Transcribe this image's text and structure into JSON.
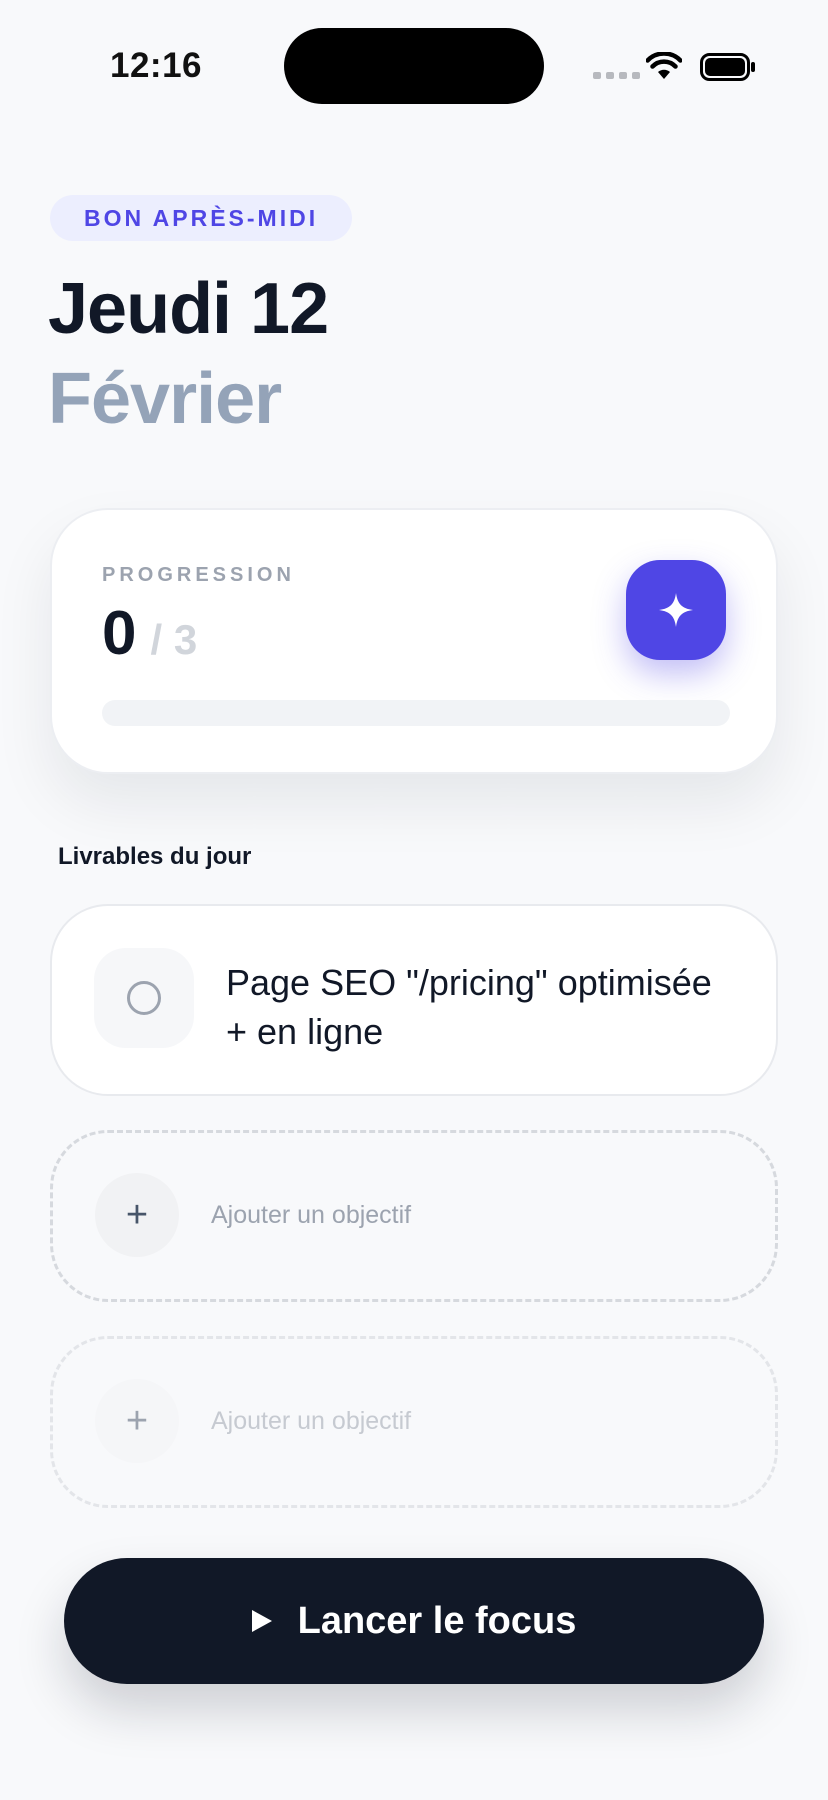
{
  "status_bar": {
    "time": "12:16"
  },
  "header": {
    "greeting": "BON APRÈS-MIDI",
    "day": "Jeudi 12",
    "month": "Février"
  },
  "progress": {
    "label": "PROGRESSION",
    "done": "0",
    "total": "/ 3",
    "fraction": 0,
    "accent": "#4f46e5",
    "icon": "sparkle-icon"
  },
  "section": {
    "title": "Livrables du jour"
  },
  "goals": [
    {
      "text": "Page SEO \"/pricing\" optimisée + en ligne",
      "done": false
    }
  ],
  "add_slots": [
    {
      "label": "Ajouter un objectif",
      "icon": "+"
    },
    {
      "label": "Ajouter un objectif",
      "icon": "+"
    }
  ],
  "cta": {
    "label": "Lancer le focus",
    "icon": "play-icon",
    "color": "#111827"
  }
}
